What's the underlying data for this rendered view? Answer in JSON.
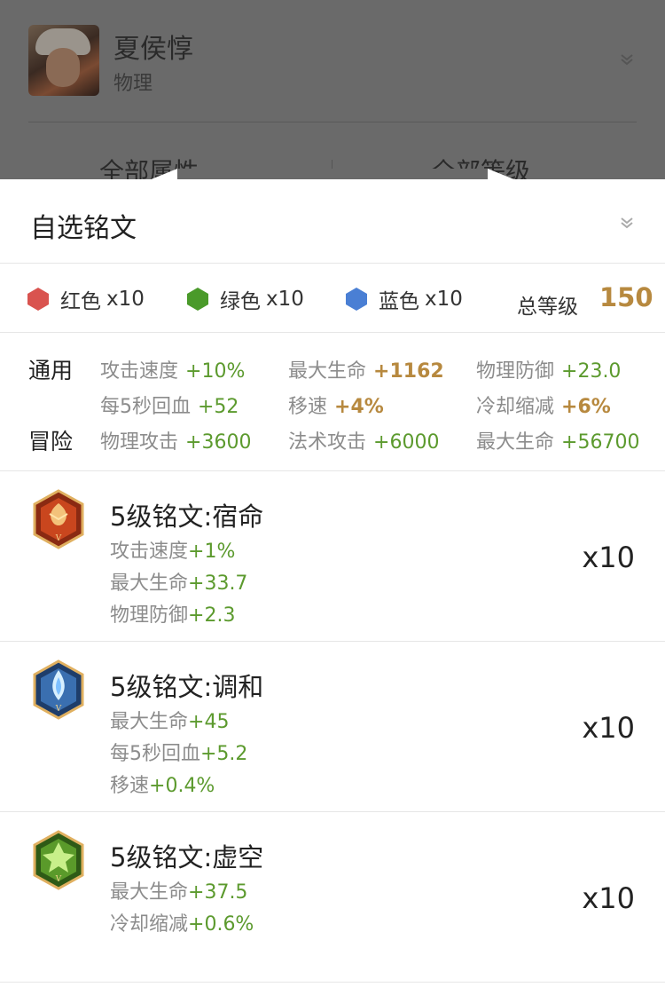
{
  "background": {
    "hero_name": "夏侯惇",
    "hero_type": "物理",
    "filter_attribute": "全部属性",
    "filter_level": "全部等级"
  },
  "sheet": {
    "title": "自选铭文",
    "colors": [
      {
        "name": "红色",
        "count": "x10",
        "hex": "#d9534f"
      },
      {
        "name": "绿色",
        "count": "x10",
        "hex": "#4a9a2a"
      },
      {
        "name": "蓝色",
        "count": "x10",
        "hex": "#4a7fd4"
      }
    ],
    "total_label": "总等级",
    "total_value": "150",
    "stats": {
      "general_label": "通用",
      "adventure_label": "冒险",
      "rows": [
        [
          {
            "label": "攻击速度",
            "value": "+10%",
            "style": "green"
          },
          {
            "label": "最大生命",
            "value": "+1162",
            "style": "gold"
          },
          {
            "label": "物理防御",
            "value": "+23.0",
            "style": "green"
          }
        ],
        [
          {
            "label": "每5秒回血",
            "value": "+52",
            "style": "green"
          },
          {
            "label": "移速",
            "value": "+4%",
            "style": "gold"
          },
          {
            "label": "冷却缩减",
            "value": "+6%",
            "style": "gold"
          }
        ],
        [
          {
            "label": "物理攻击",
            "value": "+3600",
            "style": "green"
          },
          {
            "label": "法术攻击",
            "value": "+6000",
            "style": "green"
          },
          {
            "label": "最大生命",
            "value": "+56700",
            "style": "green"
          }
        ]
      ]
    },
    "runes": [
      {
        "name": "5级铭文:宿命",
        "icon": "red-rune-icon",
        "count": "x10",
        "attrs": [
          {
            "label": "攻击速度",
            "value": "+1%"
          },
          {
            "label": "最大生命",
            "value": "+33.7"
          },
          {
            "label": "物理防御",
            "value": "+2.3"
          }
        ]
      },
      {
        "name": "5级铭文:调和",
        "icon": "blue-rune-icon",
        "count": "x10",
        "attrs": [
          {
            "label": "最大生命",
            "value": "+45"
          },
          {
            "label": "每5秒回血",
            "value": "+5.2"
          },
          {
            "label": "移速",
            "value": "+0.4%"
          }
        ]
      },
      {
        "name": "5级铭文:虚空",
        "icon": "green-rune-icon",
        "count": "x10",
        "attrs": [
          {
            "label": "最大生命",
            "value": "+37.5"
          },
          {
            "label": "冷却缩减",
            "value": "+0.6%"
          }
        ]
      }
    ]
  }
}
